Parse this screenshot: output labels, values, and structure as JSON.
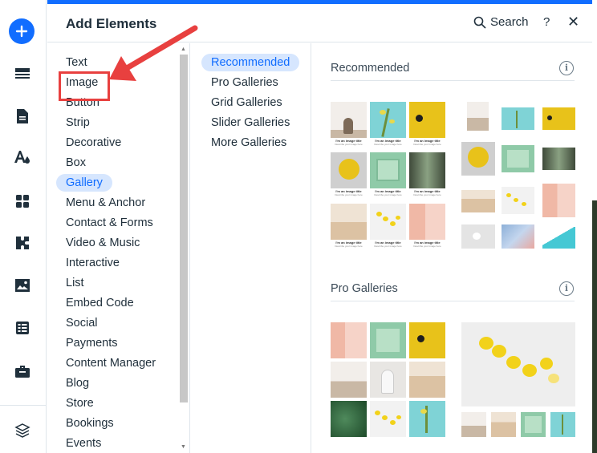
{
  "panel": {
    "title": "Add Elements",
    "search_label": "Search",
    "help_label": "?",
    "close_label": "✕"
  },
  "rail": {
    "icons": [
      "add-icon",
      "header-footer-icon",
      "pages-icon",
      "design-icon",
      "apps-icon",
      "business-icon",
      "media-icon",
      "cms-icon",
      "portfolio-icon",
      "layers-icon"
    ]
  },
  "categories": [
    {
      "label": "Text"
    },
    {
      "label": "Image"
    },
    {
      "label": "Button"
    },
    {
      "label": "Strip"
    },
    {
      "label": "Decorative"
    },
    {
      "label": "Box"
    },
    {
      "label": "Gallery"
    },
    {
      "label": "Menu & Anchor"
    },
    {
      "label": "Contact & Forms"
    },
    {
      "label": "Video & Music"
    },
    {
      "label": "Interactive"
    },
    {
      "label": "List"
    },
    {
      "label": "Embed Code"
    },
    {
      "label": "Social"
    },
    {
      "label": "Payments"
    },
    {
      "label": "Content Manager"
    },
    {
      "label": "Blog"
    },
    {
      "label": "Store"
    },
    {
      "label": "Bookings"
    },
    {
      "label": "Events"
    }
  ],
  "selected_category": "Gallery",
  "subcategories": [
    {
      "label": "Recommended"
    },
    {
      "label": "Pro Galleries"
    },
    {
      "label": "Grid Galleries"
    },
    {
      "label": "Slider Galleries"
    },
    {
      "label": "More Galleries"
    }
  ],
  "selected_subcategory": "Recommended",
  "sections": {
    "recommended": {
      "title": "Recommended",
      "info": "i"
    },
    "pro": {
      "title": "Pro Galleries",
      "info": "i"
    }
  },
  "captions": {
    "title": "I'm an image title",
    "desc": "Describe your image here"
  },
  "colors": {
    "accent": "#116dff",
    "selected_bg": "#d6e6fe",
    "annotation": "#e8403f"
  }
}
